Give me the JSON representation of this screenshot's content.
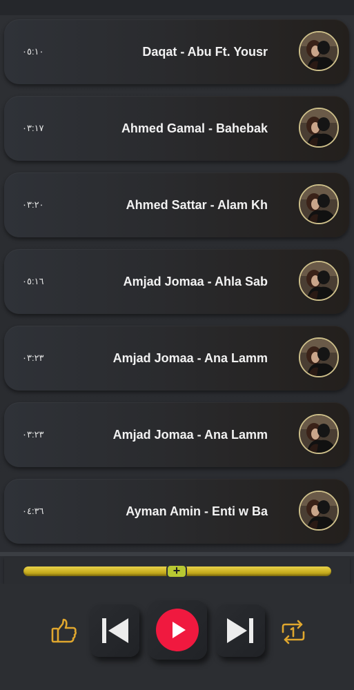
{
  "playlist": [
    {
      "title": "Daqat - Abu Ft. Yousr",
      "duration": "٠٥:١٠"
    },
    {
      "title": "Ahmed Gamal - Bahebak",
      "duration": "٠٣:١٧"
    },
    {
      "title": "Ahmed Sattar - Alam Kh",
      "duration": "٠٣:٢٠"
    },
    {
      "title": "Amjad Jomaa - Ahla Sab",
      "duration": "٠٥:١٦"
    },
    {
      "title": "Amjad Jomaa - Ana Lamm",
      "duration": "٠٣:٢٣"
    },
    {
      "title": "Amjad Jomaa - Ana Lamm",
      "duration": "٠٣:٢٣"
    },
    {
      "title": "Ayman Amin - Enti w Ba",
      "duration": "٠٤:٣٦"
    }
  ],
  "player": {
    "seek_thumb_symbol": "+",
    "seek_progress_percent": 50,
    "icons": {
      "like": "thumbs-up-icon",
      "previous": "skip-previous-icon",
      "play": "play-icon",
      "next": "skip-next-icon",
      "repeat": "repeat-one-icon"
    }
  },
  "colors": {
    "accent_yellow": "#d9bf2c",
    "play_red": "#f0193f",
    "icon_gold": "#e0a72e",
    "card_text": "#f2f2f2"
  }
}
